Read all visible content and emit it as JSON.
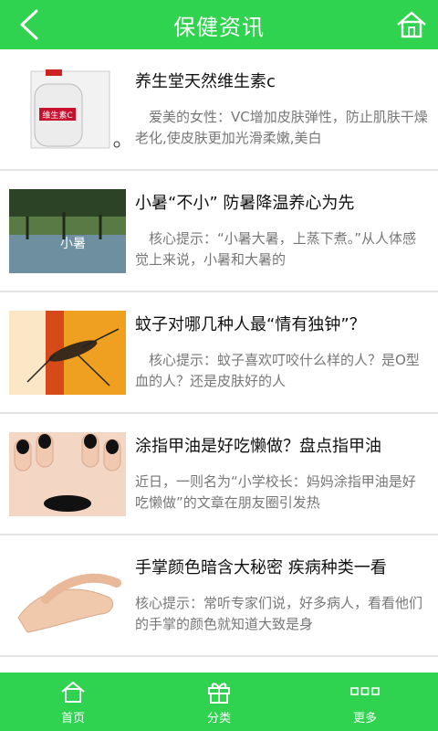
{
  "header": {
    "title": "保健资讯",
    "back_icon": "chevron-left-icon",
    "home_icon": "home-icon"
  },
  "colors": {
    "brand": "#2fd34f",
    "title_text": "#111111",
    "desc_text": "#777777"
  },
  "articles": [
    {
      "title": "养生堂天然维生素c",
      "desc": "　爱美的女性：VC增加皮肤弹性，防止肌肤干燥老化,使皮肤更加光滑柔嫩,美白",
      "thumb_text": "维生素C"
    },
    {
      "title": "小暑“不小” 防暑降温养心为先",
      "desc": "　核心提示：“小暑大暑，上蒸下煮。”从人体感觉上来说，小暑和大暑的",
      "thumb_text": "小暑"
    },
    {
      "title": "蚊子对哪几种人最“情有独钟”？",
      "desc": "　核心提示：蚊子喜欢叮咬什么样的人？是O型血的人？还是皮肤好的人",
      "thumb_text": ""
    },
    {
      "title": "涂指甲油是好吃懒做？盘点指甲油",
      "desc": "近日，一则名为“小学校长：妈妈涂指甲油是好吃懒做”的文章在朋友圈引发热",
      "thumb_text": ""
    },
    {
      "title": "手掌颜色暗含大秘密 疾病种类一看",
      "desc": "核心提示：常听专家们说，好多病人，看看他们的手掌的颜色就知道大致是身",
      "thumb_text": ""
    }
  ],
  "tabbar": {
    "tabs": [
      {
        "label": "首页",
        "icon": "home-icon"
      },
      {
        "label": "分类",
        "icon": "gift-icon"
      },
      {
        "label": "更多",
        "icon": "more-icon"
      }
    ]
  }
}
